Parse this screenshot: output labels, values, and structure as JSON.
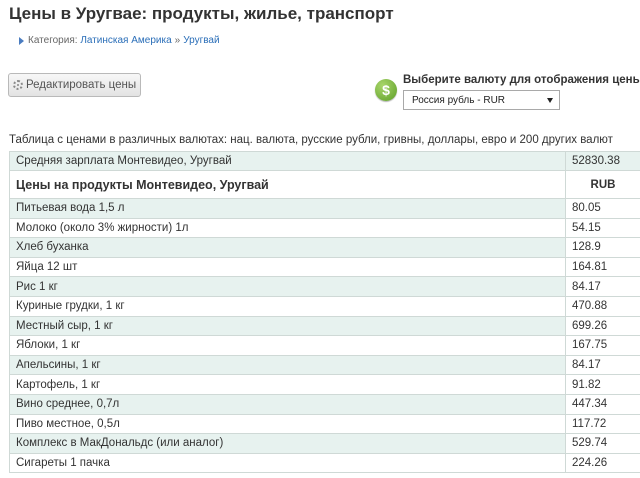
{
  "page": {
    "title": "Цены в Уругвае: продукты, жилье, транспорт"
  },
  "breadcrumb": {
    "prefix": "Категория:",
    "link1": "Латинская Америка",
    "separator": "»",
    "link2": "Уругвай"
  },
  "toolbar": {
    "edit_label": "Редактировать цены"
  },
  "currency": {
    "label": "Выберите валюту для отображения цены",
    "selected": "Россия рубль - RUR",
    "icon_symbol": "$",
    "icon_color": "#6aa832"
  },
  "table": {
    "caption": "Таблица с ценами в различных валютах: нац. валюта, русские рубли, гривны, доллары, евро и 200 других валют",
    "salary": {
      "name": "Средняя зарплата Монтевидео, Уругвай",
      "value": "52830.38"
    },
    "section_header": {
      "name": "Цены на продукты Монтевидео, Уругвай",
      "currency": "RUB"
    },
    "rows": [
      {
        "name": "Питьевая вода 1,5 л",
        "value": "80.05"
      },
      {
        "name": "Молоко (около 3% жирности) 1л",
        "value": "54.15"
      },
      {
        "name": "Хлеб буханка",
        "value": "128.9"
      },
      {
        "name": "Яйца 12 шт",
        "value": "164.81"
      },
      {
        "name": "Рис 1 кг",
        "value": "84.17"
      },
      {
        "name": "Куриные грудки, 1 кг",
        "value": "470.88"
      },
      {
        "name": "Местный сыр, 1 кг",
        "value": "699.26"
      },
      {
        "name": "Яблоки, 1 кг",
        "value": "167.75"
      },
      {
        "name": "Апельсины, 1 кг",
        "value": "84.17"
      },
      {
        "name": "Картофель, 1 кг",
        "value": "91.82"
      },
      {
        "name": "Вино среднее, 0,7л",
        "value": "447.34"
      },
      {
        "name": "Пиво местное, 0,5л",
        "value": "117.72"
      },
      {
        "name": "Комплекс в МакДональдс (или аналог)",
        "value": "529.74"
      },
      {
        "name": "Сигареты 1 пачка",
        "value": "224.26"
      }
    ]
  },
  "colors": {
    "row_stripe": "#e7f2ef",
    "link": "#2a6eb8",
    "border": "#cfd9d6"
  }
}
